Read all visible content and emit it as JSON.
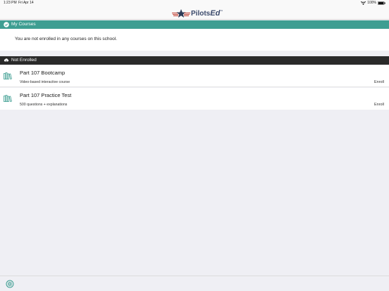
{
  "status_bar": {
    "time": "1:23 PM",
    "date": "Fri Apr 14",
    "battery": "100%",
    "icons": [
      "wifi-icon",
      "battery-icon"
    ]
  },
  "nav": {
    "logo_part1": "Pilots",
    "logo_part2": "Ed",
    "logo_tm": "™"
  },
  "my_courses": {
    "header": "My Courses",
    "icon": "check-circle-icon",
    "empty_message": "You are not enrolled in any courses on this school."
  },
  "not_enrolled": {
    "header": "Not Enrolled",
    "icon": "cloud-download-icon",
    "courses": [
      {
        "title": "Part 107 Bootcamp",
        "subtitle": "Video-based interactive course",
        "action": "Enroll",
        "icon": "books-icon"
      },
      {
        "title": "Part 107 Practice Test",
        "subtitle": "500 questions + explanations",
        "action": "Enroll",
        "icon": "books-icon"
      }
    ]
  },
  "footer": {
    "icon": "settings-icon"
  },
  "colors": {
    "accent": "#3e9e92",
    "dark_header": "#2a2a2a",
    "background": "#efeff4"
  }
}
